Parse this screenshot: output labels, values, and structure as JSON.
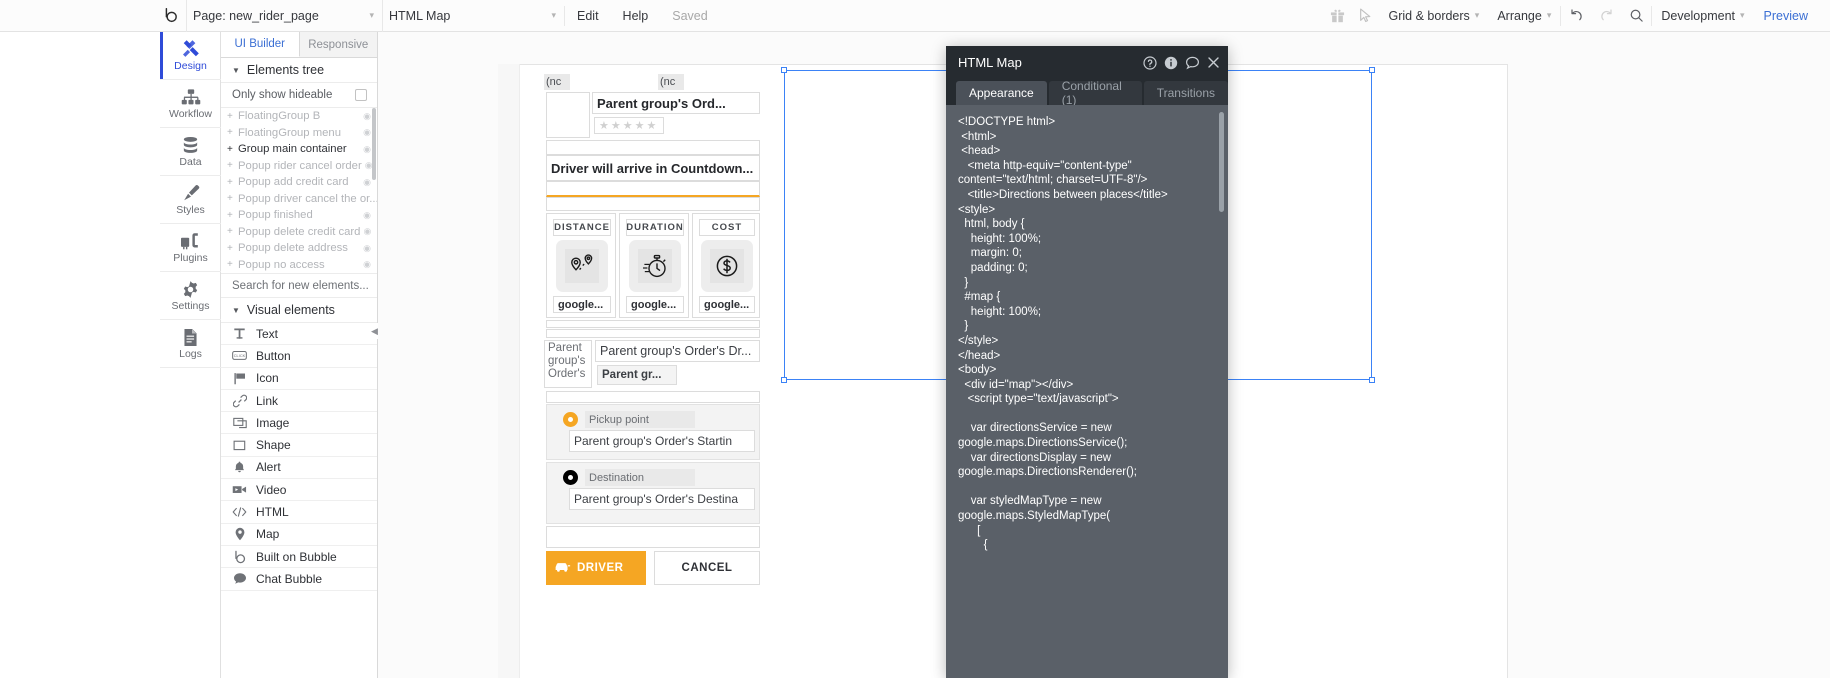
{
  "topbar": {
    "logo_icon": "bubble-logo-icon",
    "page_selector": "Page: new_rider_page",
    "element_selector": "HTML Map",
    "edit": "Edit",
    "help": "Help",
    "saved": "Saved",
    "gift_icon": "gift-icon",
    "cursor_icon": "cursor-arrow-icon",
    "grid_borders": "Grid & borders",
    "arrange": "Arrange",
    "undo_icon": "undo-icon",
    "redo_icon": "redo-icon",
    "search_icon": "search-icon",
    "development": "Development",
    "preview": "Preview",
    "caret": "▾"
  },
  "rail": {
    "items": [
      {
        "label": "Design",
        "icon": "design-icon",
        "active": true
      },
      {
        "label": "Workflow",
        "icon": "workflow-icon",
        "active": false
      },
      {
        "label": "Data",
        "icon": "data-icon",
        "active": false
      },
      {
        "label": "Styles",
        "icon": "styles-brush-icon",
        "active": false
      },
      {
        "label": "Plugins",
        "icon": "plugins-icon",
        "active": false
      },
      {
        "label": "Settings",
        "icon": "gear-icon",
        "active": false
      },
      {
        "label": "Logs",
        "icon": "logs-document-icon",
        "active": false
      }
    ]
  },
  "tree": {
    "tabs": [
      {
        "label": "UI Builder",
        "active": true
      },
      {
        "label": "Responsive",
        "active": false
      }
    ],
    "section_title": "Elements tree",
    "section_caret": "▼",
    "only_show_hideable": "Only show hideable",
    "nodes": [
      {
        "label": "FloatingGroup B",
        "strong": false
      },
      {
        "label": "FloatingGroup menu",
        "strong": false
      },
      {
        "label": "Group main container",
        "strong": true
      },
      {
        "label": "Popup rider cancel order",
        "strong": false
      },
      {
        "label": "Popup add credit card",
        "strong": false
      },
      {
        "label": "Popup driver cancel the or...",
        "strong": false
      },
      {
        "label": "Popup finished",
        "strong": false
      },
      {
        "label": "Popup delete credit card",
        "strong": false
      },
      {
        "label": "Popup delete address",
        "strong": false
      },
      {
        "label": "Popup no access",
        "strong": false
      }
    ],
    "node_plus": "+",
    "search_elements": "Search for new elements...",
    "visual_elements_title": "Visual elements",
    "visual_caret": "▼",
    "palette": [
      {
        "label": "Text",
        "icon": "text-t-icon"
      },
      {
        "label": "Button",
        "icon": "button-icon"
      },
      {
        "label": "Icon",
        "icon": "flag-icon"
      },
      {
        "label": "Link",
        "icon": "link-chain-icon"
      },
      {
        "label": "Image",
        "icon": "image-icon"
      },
      {
        "label": "Shape",
        "icon": "shape-square-icon"
      },
      {
        "label": "Alert",
        "icon": "alert-bell-icon"
      },
      {
        "label": "Video",
        "icon": "video-camera-icon"
      },
      {
        "label": "HTML",
        "icon": "html-code-icon"
      },
      {
        "label": "Map",
        "icon": "map-pin-icon"
      },
      {
        "label": "Built on Bubble",
        "icon": "bubble-logo-icon"
      },
      {
        "label": "Chat Bubble",
        "icon": "chat-bubble-icon"
      }
    ]
  },
  "canvas": {
    "collapse_handle": "◀",
    "mock": {
      "nc_left": "(nc",
      "nc_right": "(nc",
      "order_title": "Parent group's Ord...",
      "stars": "★★★★★",
      "countdown": "Driver will arrive in Countdown...",
      "stats": [
        {
          "caption": "DISTANCE",
          "icon": "route-pin-icon",
          "value": "google..."
        },
        {
          "caption": "DURATION",
          "icon": "stopwatch-icon",
          "value": "google..."
        },
        {
          "caption": "COST",
          "icon": "dollar-coin-icon",
          "value": "google..."
        }
      ],
      "driver_block_left": "Parent group's Order's",
      "driver_block_title": "Parent group's Order's Dr...",
      "driver_block_sub": "Parent gr...",
      "pickup_label": "Pickup point",
      "pickup_icon": "pickup-dot-icon",
      "pickup_value": "Parent group's Order's Startin",
      "destination_label": "Destination",
      "destination_icon": "destination-dot-icon",
      "destination_value": "Parent group's Order's Destina",
      "driver_button": "DRIVER",
      "driver_button_icon": "car-icon",
      "cancel_button": "CANCEL"
    }
  },
  "property_editor": {
    "title": "HTML Map",
    "head_icons": [
      {
        "name": "help-question-icon",
        "glyph": "?"
      },
      {
        "name": "info-icon",
        "glyph": "i"
      },
      {
        "name": "comment-icon",
        "glyph": "○"
      },
      {
        "name": "close-icon",
        "glyph": "✕"
      }
    ],
    "tabs": [
      {
        "label": "Appearance",
        "active": true
      },
      {
        "label": "Conditional (1)",
        "active": false
      },
      {
        "label": "Transitions",
        "active": false
      }
    ],
    "code": "<!DOCTYPE html>\n <html>\n <head>\n   <meta http-equiv=\"content-type\" content=\"text/html; charset=UTF-8\"/>\n   <title>Directions between places</title>\n<style>\n  html, body {\n    height: 100%;\n    margin: 0;\n    padding: 0;\n  }\n  #map {\n    height: 100%;\n  }\n</style>\n</head>\n<body>\n  <div id=\"map\"></div>\n   <script type=\"text/javascript\">\n\n    var directionsService = new google.maps.DirectionsService();\n    var directionsDisplay = new google.maps.DirectionsRenderer();\n\n    var styledMapType = new google.maps.StyledMapType(\n      [\n        {"
  },
  "colors": {
    "accent_blue": "#3b6fd4",
    "active_rail": "#2f4bd8",
    "panel_dark": "#262b30",
    "panel_body": "#5a6068",
    "orange": "#f5a623",
    "selection": "#3b82f6"
  }
}
